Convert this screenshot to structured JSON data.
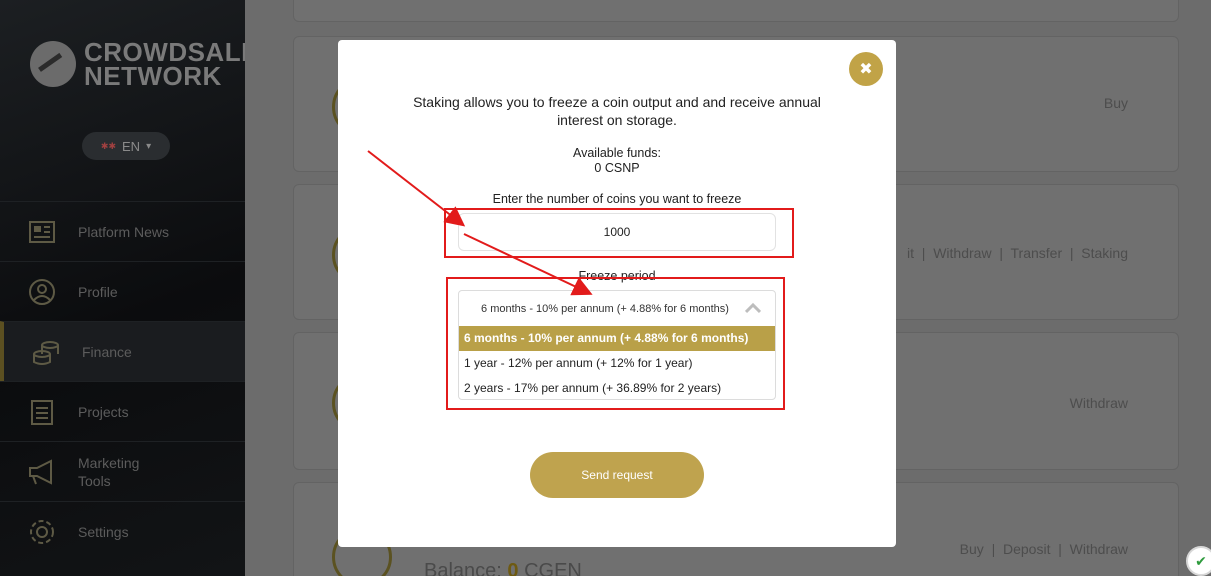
{
  "sidebar": {
    "logo": {
      "line1": "CROWDSALE",
      "line2": "NETWORK"
    },
    "language": {
      "flag": "✱✱",
      "label": "EN"
    },
    "items": [
      {
        "label": "Platform News"
      },
      {
        "label": "Profile"
      },
      {
        "label": "Finance"
      },
      {
        "label": "Projects"
      },
      {
        "label": "Marketing Tools"
      },
      {
        "label": "Settings"
      }
    ]
  },
  "main": {
    "cards": [
      {
        "actions": "Buy"
      },
      {
        "actions": "it  |  Withdraw  |  Transfer  |  Staking"
      },
      {
        "actions": "Withdraw"
      },
      {
        "actions": "Buy  |  Deposit  |  Withdraw",
        "balance_label": "Balance:",
        "balance_value": "0",
        "balance_currency": "CGEN"
      }
    ]
  },
  "modal": {
    "close_symbol": "✖",
    "intro": "Staking allows you to freeze a coin output and and receive annual interest on storage.",
    "funds_label": "Available funds:",
    "funds_value": "0 CSNP",
    "enter_label": "Enter the number of coins you want to freeze",
    "coins_value": "1000",
    "period_label": "Freeze period",
    "period_selected": "6 months - 10% per annum (+ 4.88% for 6 months)",
    "period_options": [
      "6 months - 10% per annum (+ 4.88% for 6 months)",
      "1 year - 12% per annum (+ 12% for 1 year)",
      "2 years - 17% per annum (+ 36.89% for 2 years)"
    ],
    "send_label": "Send request"
  },
  "colors": {
    "accent": "#bfa34e",
    "annotation": "#e21b1b"
  },
  "icons": [
    "news-icon",
    "profile-icon",
    "coins-icon",
    "clipboard-icon",
    "megaphone-icon",
    "gear-icon",
    "shield-check-icon",
    "close-icon",
    "chevron-up-icon"
  ]
}
